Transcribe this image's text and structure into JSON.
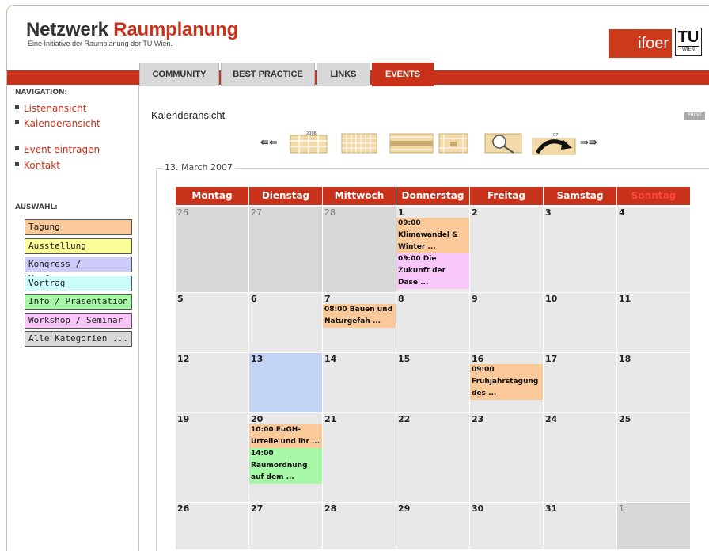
{
  "header": {
    "logo_word1": "Netzwerk",
    "logo_word2": "Raumplanung",
    "tagline": "Eine Initiative der Raumplanung der TU Wien.",
    "ifoer": "ifoer",
    "tu_top": "TU",
    "tu_bottom": "WIEN"
  },
  "tabs": [
    "COMMUNITY",
    "BEST PRACTICE",
    "LINKS",
    "EVENTS"
  ],
  "active_tab": "EVENTS",
  "sidebar": {
    "nav_heading": "NAVIGATION:",
    "nav_items": [
      "Listenansicht",
      "Kalenderansicht",
      "Event eintragen",
      "Kontakt"
    ],
    "select_heading": "AUSWAHL:",
    "categories": [
      {
        "label": "Tagung",
        "color": "#f9c99a"
      },
      {
        "label": "Ausstellung",
        "color": "#fcfc98"
      },
      {
        "label": "Kongress / Konferenz",
        "color": "#ccccfa"
      },
      {
        "label": "Vortrag",
        "color": "#ccfcfc"
      },
      {
        "label": "Info / Präsentation",
        "color": "#a6f8a6"
      },
      {
        "label": "Workshop / Seminar",
        "color": "#f8c6f8"
      },
      {
        "label": "Alle Kategorien ...",
        "color": "#d8d8d8"
      }
    ]
  },
  "main": {
    "title": "Kalenderansicht",
    "print_label": "PRINT",
    "year_label": "2006",
    "year_label2": "07",
    "date_legend": "13. March 2007"
  },
  "calendar": {
    "weekdays": [
      "Montag",
      "Dienstag",
      "Mittwoch",
      "Donnerstag",
      "Freitag",
      "Samstag",
      "Sonntag"
    ],
    "weeks": [
      [
        {
          "day": "26",
          "other": true,
          "events": []
        },
        {
          "day": "27",
          "other": true,
          "events": []
        },
        {
          "day": "28",
          "other": true,
          "events": []
        },
        {
          "day": "1",
          "events": [
            {
              "text": "09:00 Klimawandel & Winter ...",
              "type": "or"
            },
            {
              "text": "09:00 Die Zukunft der Dase ...",
              "type": "pk"
            }
          ]
        },
        {
          "day": "2",
          "events": []
        },
        {
          "day": "3",
          "events": []
        },
        {
          "day": "4",
          "events": []
        }
      ],
      [
        {
          "day": "5",
          "events": []
        },
        {
          "day": "6",
          "events": []
        },
        {
          "day": "7",
          "events": [
            {
              "text": "08:00 Bauen und Naturgefah ...",
              "type": "or"
            }
          ]
        },
        {
          "day": "8",
          "events": []
        },
        {
          "day": "9",
          "events": []
        },
        {
          "day": "10",
          "events": []
        },
        {
          "day": "11",
          "events": []
        }
      ],
      [
        {
          "day": "12",
          "events": []
        },
        {
          "day": "13",
          "today": true,
          "events": []
        },
        {
          "day": "14",
          "events": []
        },
        {
          "day": "15",
          "events": []
        },
        {
          "day": "16",
          "events": [
            {
              "text": "09:00 Frühjahrstagung des ...",
              "type": "or"
            }
          ]
        },
        {
          "day": "17",
          "events": []
        },
        {
          "day": "18",
          "events": []
        }
      ],
      [
        {
          "day": "19",
          "events": []
        },
        {
          "day": "20",
          "events": [
            {
              "text": "10:00 EuGH-Urteile und ihr ...",
              "type": "or"
            },
            {
              "text": "14:00 Raumordnung auf dem ...",
              "type": "gr"
            }
          ]
        },
        {
          "day": "21",
          "events": []
        },
        {
          "day": "22",
          "events": []
        },
        {
          "day": "23",
          "events": []
        },
        {
          "day": "24",
          "events": []
        },
        {
          "day": "25",
          "events": []
        }
      ],
      [
        {
          "day": "26",
          "events": []
        },
        {
          "day": "27",
          "events": []
        },
        {
          "day": "28",
          "events": []
        },
        {
          "day": "29",
          "events": []
        },
        {
          "day": "30",
          "events": []
        },
        {
          "day": "31",
          "events": []
        },
        {
          "day": "1",
          "other": true,
          "events": []
        }
      ]
    ]
  }
}
